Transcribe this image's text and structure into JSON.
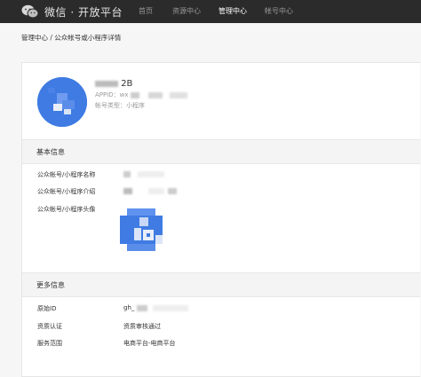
{
  "header": {
    "brand": "微信 · 开放平台",
    "nav": [
      "首页",
      "资源中心",
      "管理中心",
      "帐号中心"
    ],
    "active_nav": "管理中心"
  },
  "breadcrumb": "管理中心 / 公众帐号或小程序详情",
  "account": {
    "name": "2B",
    "appid_label": "APPID：wx",
    "type": "帐号类型：小程序"
  },
  "basic_info": {
    "title": "基本信息",
    "rows": [
      {
        "label": "公众帐号/小程序名称"
      },
      {
        "label": "公众帐号/小程序介绍"
      },
      {
        "label": "公众帐号/小程序头像"
      }
    ]
  },
  "more_info": {
    "title": "更多信息",
    "rows": [
      {
        "label": "原始ID",
        "value": "gh_"
      },
      {
        "label": "资质认证",
        "value": "资质审核通过"
      },
      {
        "label": "服务范围",
        "value": "电商平台-电商平台"
      }
    ]
  },
  "colors": {
    "topbar": "#2b2b2b",
    "avatar_blue": "#3f7be3",
    "page_bg": "#f6f6f6"
  }
}
